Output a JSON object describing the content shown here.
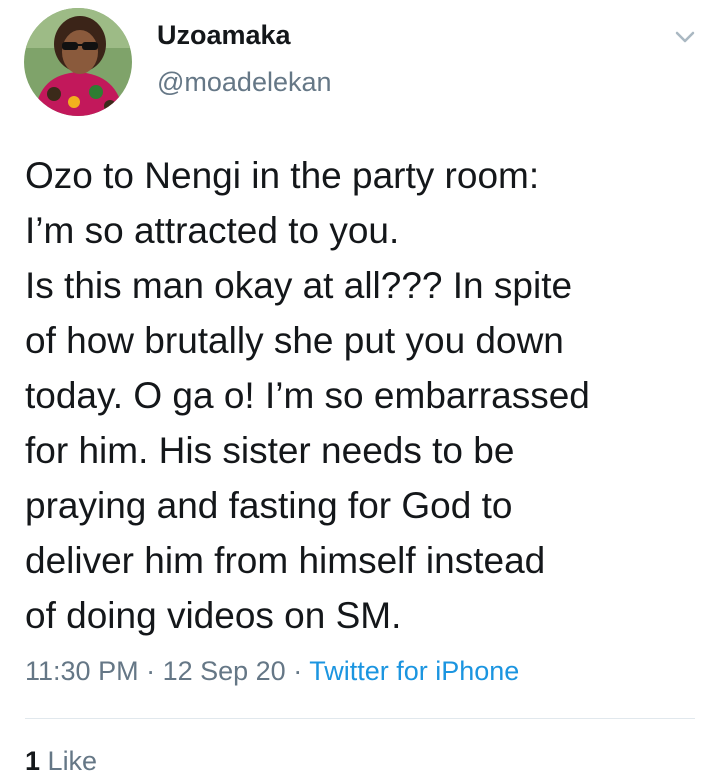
{
  "user": {
    "display_name": "Uzoamaka",
    "handle": "@moadelekan",
    "avatar_icon": "profile-photo"
  },
  "menu_icon": "chevron-down-icon",
  "tweet": {
    "lines": [
      "Ozo to Nengi in the party room:",
      "I’m so attracted to you.",
      "Is this man okay at all??? In spite",
      "of how brutally she put you down",
      "today. O ga o! I’m so embarrassed",
      "for him. His sister needs to be",
      "praying and fasting for God to",
      "deliver him from himself instead",
      "of doing videos on SM."
    ]
  },
  "meta": {
    "time": "11:30 PM",
    "sep1": " · ",
    "date": "12 Sep 20",
    "sep2": " · ",
    "source": "Twitter for iPhone"
  },
  "stats": {
    "likes_count": "1",
    "likes_label": "Like"
  },
  "colors": {
    "text": "#14171a",
    "secondary": "#657786",
    "link": "#1b95e0",
    "divider": "#e1e8ed"
  }
}
